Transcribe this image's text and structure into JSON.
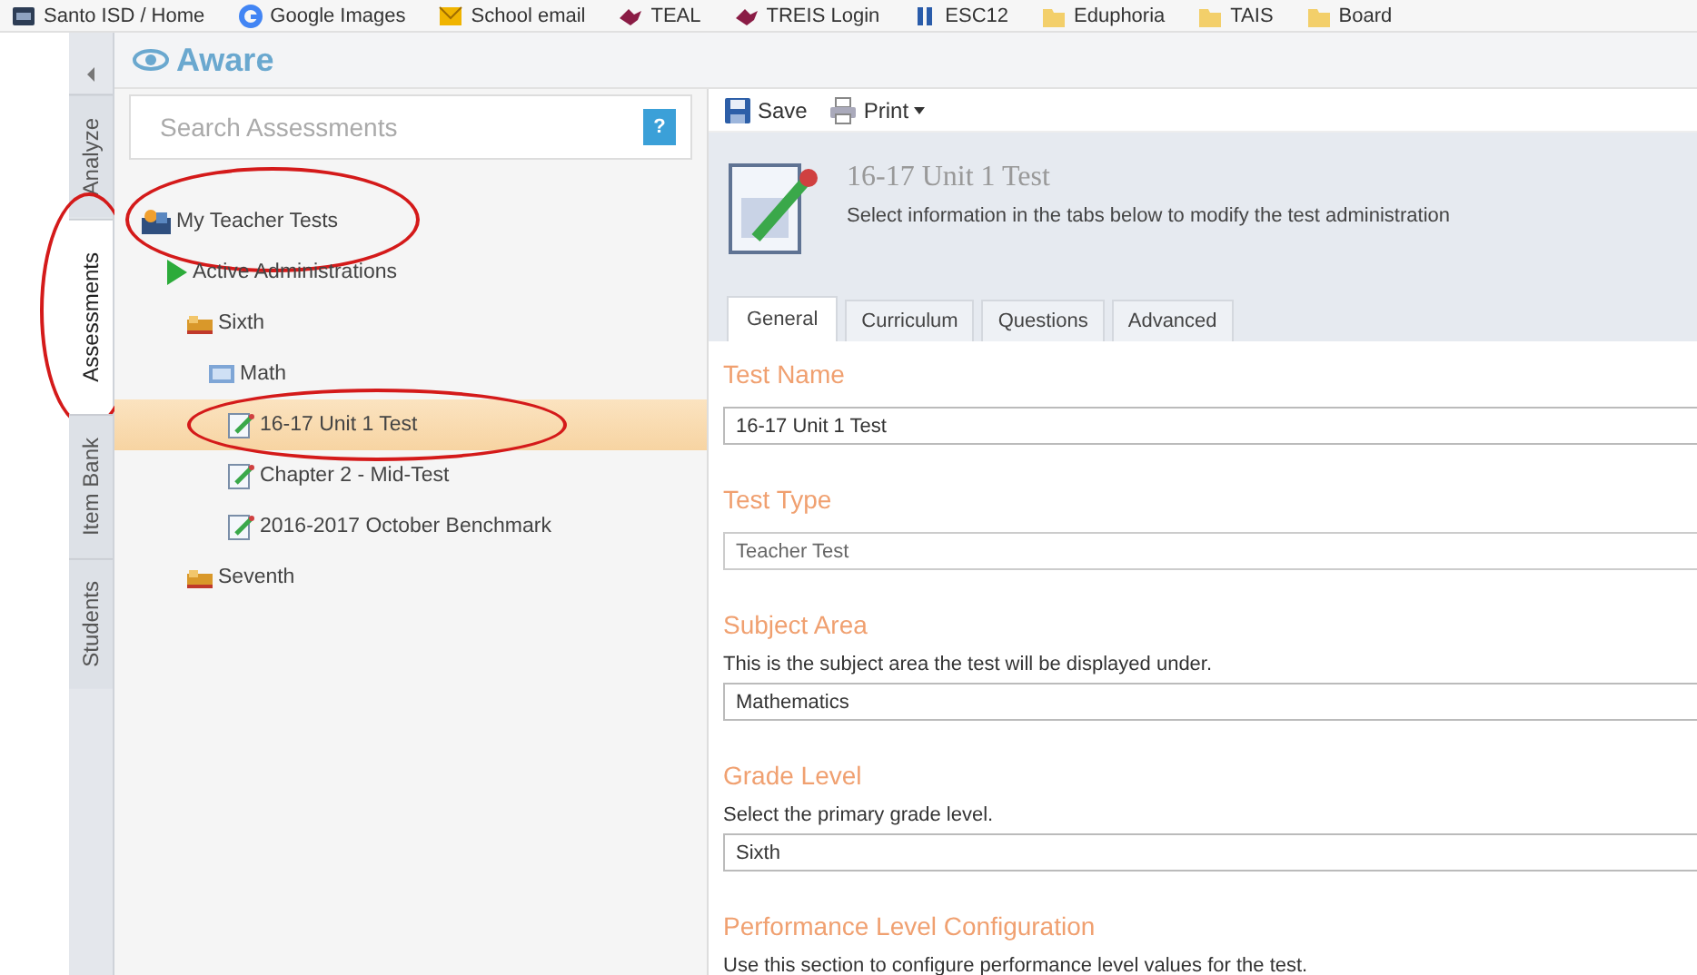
{
  "bookmarks": [
    {
      "label": "Santo ISD / Home",
      "kind": "site"
    },
    {
      "label": "Google Images",
      "kind": "google"
    },
    {
      "label": "School email",
      "kind": "mail"
    },
    {
      "label": "TEAL",
      "kind": "bird"
    },
    {
      "label": "TREIS Login",
      "kind": "bird"
    },
    {
      "label": "ESC12",
      "kind": "bars"
    },
    {
      "label": "Eduphoria",
      "kind": "folder"
    },
    {
      "label": "TAIS",
      "kind": "folder"
    },
    {
      "label": "Board",
      "kind": "folder"
    }
  ],
  "app": {
    "title": "Aware"
  },
  "side_tabs": [
    {
      "label": "Analyze",
      "selected": false,
      "circled": false
    },
    {
      "label": "Assessments",
      "selected": true,
      "circled": true
    },
    {
      "label": "Item Bank",
      "selected": false,
      "circled": false
    },
    {
      "label": "Students",
      "selected": false,
      "circled": false
    }
  ],
  "search": {
    "placeholder": "Search Assessments",
    "help": "?"
  },
  "tree": [
    {
      "label": "My Teacher Tests",
      "kind": "teacher",
      "selected": false,
      "circled": true,
      "children": [
        {
          "label": "Active Administrations",
          "kind": "play",
          "selected": false,
          "circled": false,
          "children": [
            {
              "label": "Sixth",
              "kind": "grade",
              "selected": false,
              "circled": false,
              "children": [
                {
                  "label": "Math",
                  "kind": "subject",
                  "selected": false,
                  "circled": false,
                  "children": [
                    {
                      "label": "16-17 Unit 1 Test",
                      "kind": "test",
                      "selected": true,
                      "circled": true
                    },
                    {
                      "label": "Chapter 2 - Mid-Test",
                      "kind": "test",
                      "selected": false,
                      "circled": false
                    },
                    {
                      "label": "2016-2017 October Benchmark",
                      "kind": "test",
                      "selected": false,
                      "circled": false
                    }
                  ]
                }
              ]
            },
            {
              "label": "Seventh",
              "kind": "grade",
              "selected": false,
              "circled": false
            }
          ]
        }
      ]
    }
  ],
  "toolbar": [
    {
      "label": "Save",
      "kind": "save"
    },
    {
      "label": "Print",
      "kind": "print"
    }
  ],
  "header": {
    "title": "16-17 Unit 1 Test",
    "subtitle": "Select information in the tabs below to modify the test administration"
  },
  "tabs": [
    {
      "label": "General",
      "selected": true
    },
    {
      "label": "Curriculum",
      "selected": false
    },
    {
      "label": "Questions",
      "selected": false
    },
    {
      "label": "Advanced",
      "selected": false
    }
  ],
  "form": [
    {
      "label": "Test Name",
      "value": "16-17 Unit 1 Test",
      "disabled": false
    },
    {
      "label": "Test Type",
      "value": "Teacher Test",
      "disabled": true
    },
    {
      "label": "Subject Area",
      "description": "This is the subject area the test will be displayed under.",
      "value": "Mathematics",
      "disabled": false
    },
    {
      "label": "Grade Level",
      "description": "Select the primary grade level.",
      "value": "Sixth",
      "disabled": false
    },
    {
      "label": "Performance Level Configuration",
      "description": "Use this section to configure performance level values for the test."
    }
  ]
}
